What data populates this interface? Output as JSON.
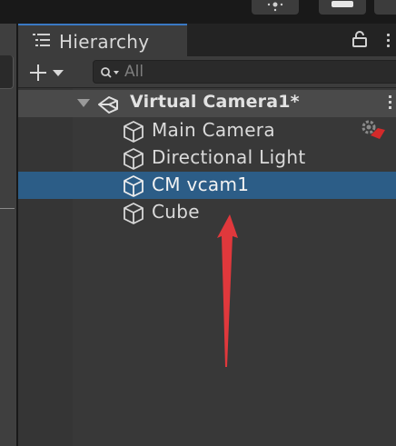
{
  "hierarchy": {
    "tab_title": "Hierarchy",
    "search": {
      "placeholder": "All",
      "value": ""
    },
    "scene": {
      "name": "Virtual Camera1*"
    },
    "items": [
      {
        "label": "Main Camera",
        "selected": false,
        "has_gizmo_icon": true
      },
      {
        "label": "Directional Light",
        "selected": false
      },
      {
        "label": "CM vcam1",
        "selected": true
      },
      {
        "label": "Cube",
        "selected": false
      }
    ]
  },
  "icons": {
    "tab": "list-icon",
    "lock": "lock-icon",
    "add": "plus-icon",
    "search": "search-icon",
    "scene": "unity-logo-icon",
    "object": "cube-icon"
  },
  "colors": {
    "selection": "#2c5d87",
    "tab_accent": "#3a79c4",
    "annotation_arrow": "#e0383c"
  }
}
